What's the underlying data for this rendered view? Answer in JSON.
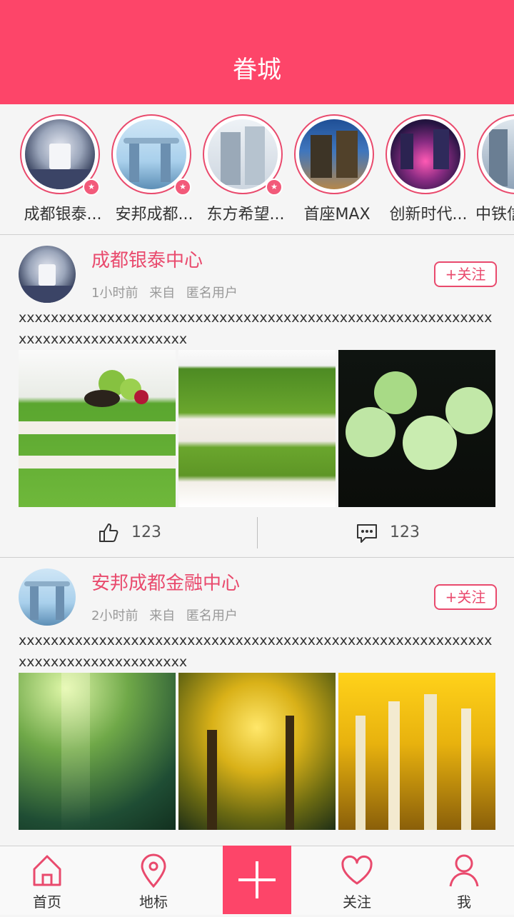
{
  "header": {
    "title": "眷城"
  },
  "stories": [
    {
      "label": "成都银泰...",
      "hot": true
    },
    {
      "label": "安邦成都...",
      "hot": true
    },
    {
      "label": "东方希望...",
      "hot": true
    },
    {
      "label": "首座MAX",
      "hot": false
    },
    {
      "label": "创新时代...",
      "hot": false
    },
    {
      "label": "中铁信",
      "hot": false
    }
  ],
  "posts": [
    {
      "name": "成都银泰中心",
      "time": "1小时前",
      "from_label": "来自",
      "user": "匿名用户",
      "follow_label": "+关注",
      "text": "xxxxxxxxxxxxxxxxxxxxxxxxxxxxxxxxxxxxxxxxxxxxxxxxxxxxxxxxxxxxxxxxxxxxxxxxxxxxxxxx",
      "likes": "123",
      "comments": "123"
    },
    {
      "name": "安邦成都金融中心",
      "time": "2小时前",
      "from_label": "来自",
      "user": "匿名用户",
      "follow_label": "+关注",
      "text": "xxxxxxxxxxxxxxxxxxxxxxxxxxxxxxxxxxxxxxxxxxxxxxxxxxxxxxxxxxxxxxxxxxxxxxxxxxxxxxxx",
      "likes": "123",
      "comments": "123"
    }
  ],
  "tabbar": {
    "home": "首页",
    "landmark": "地标",
    "follow": "关注",
    "me": "我"
  },
  "colors": {
    "brand": "#fd4569",
    "accent": "#e94a6d"
  }
}
